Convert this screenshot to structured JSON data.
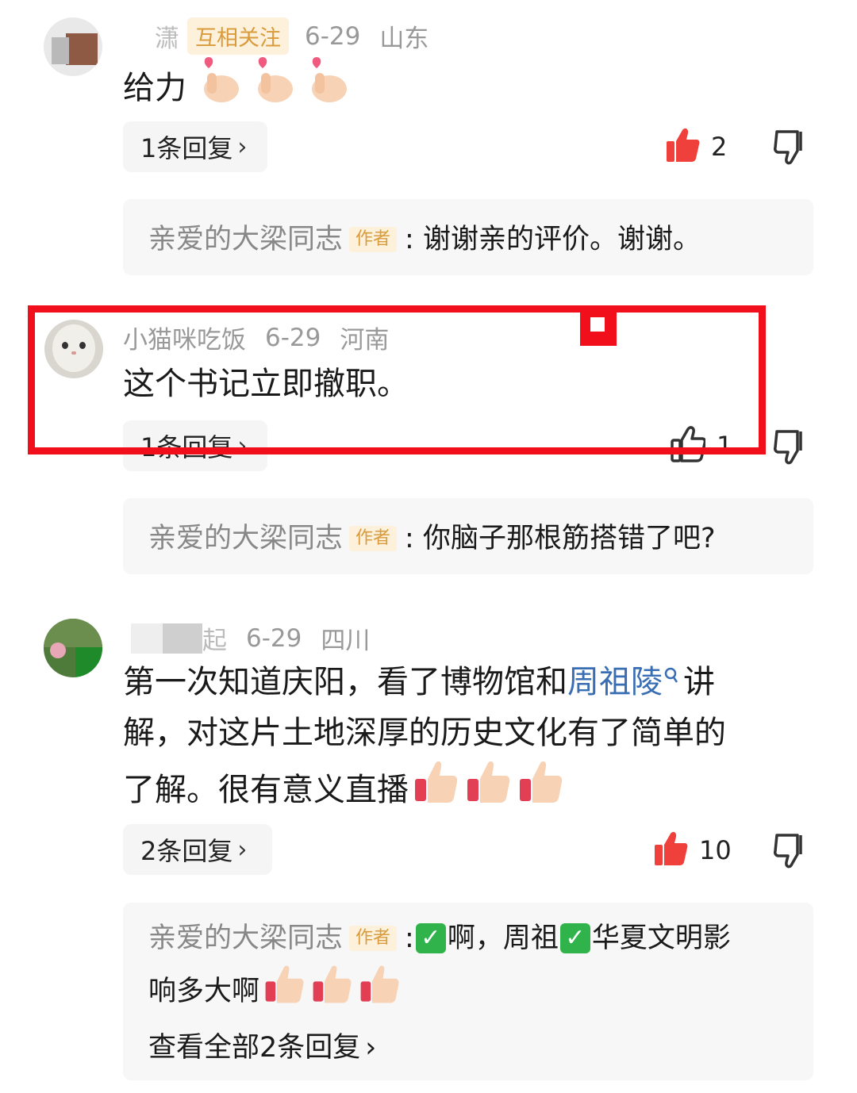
{
  "comments": [
    {
      "user": "潇",
      "badge": "互相关注",
      "date": "6-29",
      "location": "山东",
      "text": "给力",
      "reply_btn": "1条回复",
      "likes": "2",
      "reply": {
        "author": "亲爱的大梁同志",
        "tag": "作者",
        "text": ": 谢谢亲的评价。谢谢。"
      }
    },
    {
      "user": "小猫咪吃饭",
      "date": "6-29",
      "location": "河南",
      "text": "这个书记立即撤职。",
      "reply_btn": "1条回复",
      "likes": "1",
      "reply": {
        "author": "亲爱的大梁同志",
        "tag": "作者",
        "text": ": 你脑子那根筋搭错了吧?"
      }
    },
    {
      "user": "起",
      "date": "6-29",
      "location": "四川",
      "text_line1_a": "第一次知道庆阳，看了博物馆和",
      "text_line1_link": "周祖陵",
      "text_line1_b": "讲",
      "text_line2": "解，对这片土地深厚的历史文化有了简单的",
      "text_line3": "了解。很有意义直播",
      "reply_btn": "2条回复",
      "likes": "10",
      "reply": {
        "author": "亲爱的大梁同志",
        "tag": "作者",
        "text_a": ": ",
        "text_b": "啊，周祖",
        "text_c": "华夏文明影",
        "text_line2": "响多大啊",
        "view_all": "查看全部2条回复"
      }
    }
  ],
  "colors": {
    "like_red": "#f0403c",
    "highlight": "#f10f1c",
    "link": "#3a6eb4",
    "badge": "#d99b3c"
  },
  "icons": [
    "thumbs-up-icon",
    "thumbs-down-icon",
    "chevron-right-icon",
    "search-mini-icon",
    "check-emoji-icon",
    "finger-heart-emoji-icon",
    "thumb-emoji-icon"
  ]
}
